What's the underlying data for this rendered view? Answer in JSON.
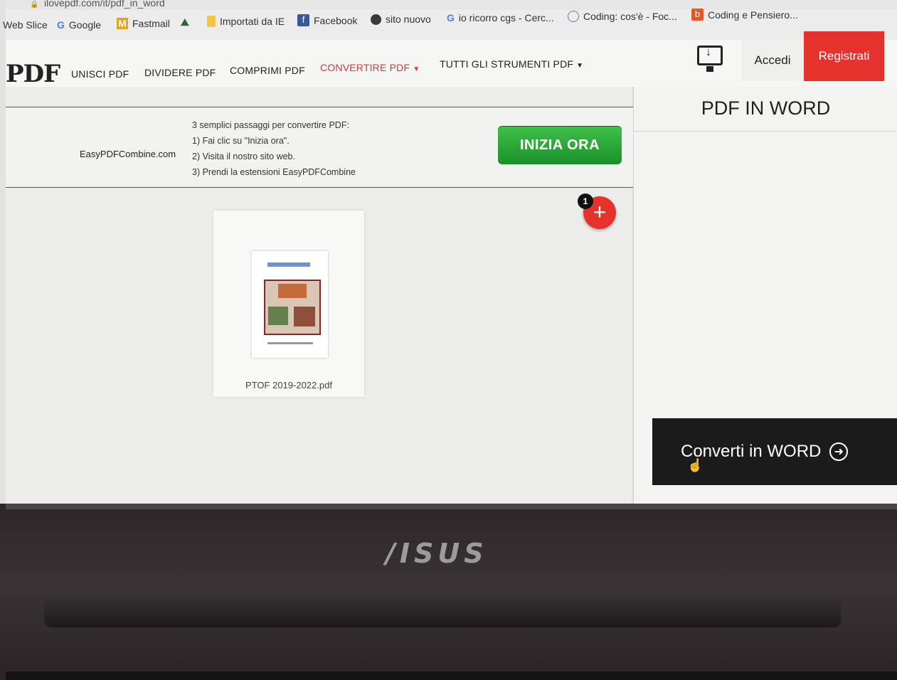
{
  "browser": {
    "url": "ilovepdf.com/it/pdf_in_word",
    "bookmarks": [
      {
        "label": "Web Slice",
        "icon": "none"
      },
      {
        "label": "Google",
        "icon": "google-icon"
      },
      {
        "label": "Fastmail",
        "icon": "fastmail-icon"
      },
      {
        "label": "",
        "icon": "palm-icon"
      },
      {
        "label": "Importati da IE",
        "icon": "folder-icon"
      },
      {
        "label": "Facebook",
        "icon": "facebook-icon"
      },
      {
        "label": "sito nuovo",
        "icon": "globe-icon"
      },
      {
        "label": "io ricorro cgs - Cerc...",
        "icon": "google-icon"
      },
      {
        "label": "Coding: cos'è - Foc...",
        "icon": "coding-icon"
      },
      {
        "label": "Coding e Pensiero...",
        "icon": "blogger-icon"
      }
    ]
  },
  "site": {
    "logo": "PDF",
    "nav": [
      {
        "label": "UNISCI PDF"
      },
      {
        "label": "DIVIDERE PDF"
      },
      {
        "label": "COMPRIMI PDF"
      },
      {
        "label": "CONVERTIRE PDF",
        "active": true
      },
      {
        "label": "TUTTI GLI STRUMENTI PDF"
      }
    ],
    "login": "Accedi",
    "signup": "Registrati",
    "brand_color": "#e5322d"
  },
  "ad": {
    "brand": "EasyPDFCombine.com",
    "steps": [
      "3 semplici passaggi per convertire PDF:",
      "1) Fai clic su \"Inizia ora\".",
      "2) Visita il nostro sito web.",
      "3) Prendi la estensioni EasyPDFCombine"
    ],
    "cta": "INIZIA ORA"
  },
  "workspace": {
    "file_name": "PTOF 2019-2022.pdf",
    "file_count_badge": "1",
    "add_symbol": "+"
  },
  "sidebar": {
    "title": "PDF IN WORD",
    "convert_button": "Converti in WORD"
  },
  "laptop": {
    "logo": "/ISUS"
  }
}
